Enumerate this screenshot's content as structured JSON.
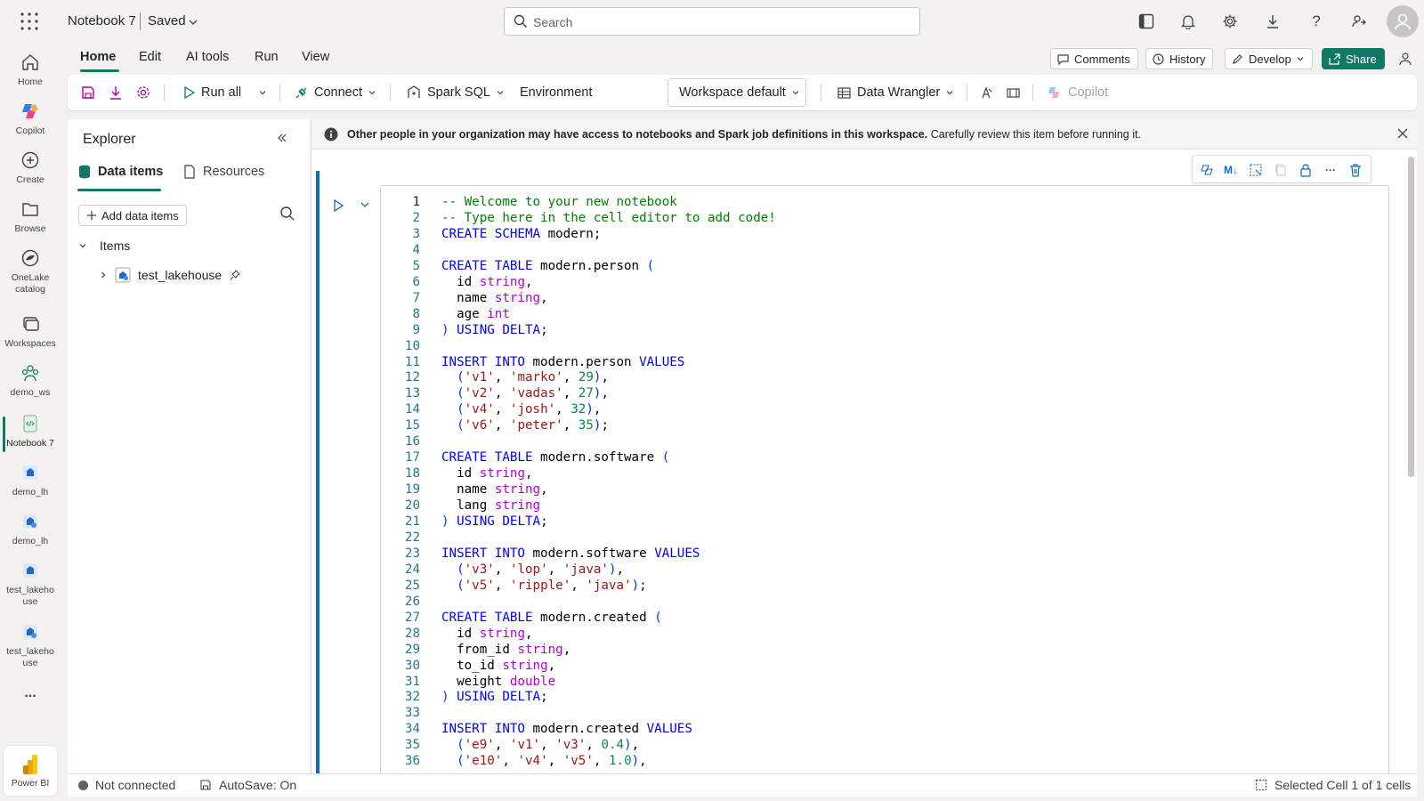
{
  "header": {
    "notebook_title": "Notebook 7",
    "save_status": "Saved",
    "search_placeholder": "Search",
    "icons": [
      "app-launcher-icon",
      "layout-icon",
      "bell-icon",
      "gear-icon",
      "download-icon",
      "help-icon",
      "share-people-icon",
      "avatar-icon"
    ]
  },
  "rail": {
    "items": [
      {
        "label": "Home",
        "icon": "home-icon"
      },
      {
        "label": "Copilot",
        "icon": "copilot-icon"
      },
      {
        "label": "Create",
        "icon": "plus-circle-icon"
      },
      {
        "label": "Browse",
        "icon": "folder-icon"
      },
      {
        "label": "OneLake catalog",
        "icon": "onelake-icon"
      },
      {
        "label": "Workspaces",
        "icon": "workspaces-icon"
      },
      {
        "label": "demo_ws",
        "icon": "workspace-people-icon"
      },
      {
        "label": "Notebook 7",
        "icon": "notebook-icon"
      },
      {
        "label": "demo_lh",
        "icon": "lakehouse-icon"
      },
      {
        "label": "demo_lh",
        "icon": "lakehouse-icon"
      },
      {
        "label": "test_lakehouse",
        "icon": "lakehouse-icon"
      },
      {
        "label": "test_lakehouse",
        "icon": "lakehouse-icon"
      }
    ],
    "more": "...",
    "powerbi": "Power BI"
  },
  "ribbon": {
    "tabs": [
      "Home",
      "Edit",
      "AI tools",
      "Run",
      "View"
    ],
    "comments": "Comments",
    "history": "History",
    "develop": "Develop",
    "share": "Share",
    "run_all": "Run all",
    "connect": "Connect",
    "language": "Spark SQL",
    "environment_label": "Environment",
    "environment_value": "Workspace default",
    "data_wrangler": "Data Wrangler",
    "copilot": "Copilot"
  },
  "explorer": {
    "title": "Explorer",
    "tab_data": "Data items",
    "tab_resources": "Resources",
    "add_button": "Add data items",
    "section": "Items",
    "tree_item": "test_lakehouse"
  },
  "notebook": {
    "banner_bold": "Other people in your organization may have access to notebooks and Spark job definitions in this workspace.",
    "banner_text": "Carefully review this item before running it.",
    "cell_tool_md": "M↓"
  },
  "code_lines": [
    "-- Welcome to your new notebook",
    "-- Type here in the cell editor to add code!",
    "CREATE SCHEMA modern;",
    "",
    "CREATE TABLE modern.person (",
    "  id string,",
    "  name string,",
    "  age int",
    ") USING DELTA;",
    "",
    "INSERT INTO modern.person VALUES",
    "  ('v1', 'marko', 29),",
    "  ('v2', 'vadas', 27),",
    "  ('v4', 'josh', 32),",
    "  ('v6', 'peter', 35);",
    "",
    "CREATE TABLE modern.software (",
    "  id string,",
    "  name string,",
    "  lang string",
    ") USING DELTA;",
    "",
    "INSERT INTO modern.software VALUES",
    "  ('v3', 'lop', 'java'),",
    "  ('v5', 'ripple', 'java');",
    "",
    "CREATE TABLE modern.created (",
    "  id string,",
    "  from_id string,",
    "  to_id string,",
    "  weight double",
    ") USING DELTA;",
    "",
    "INSERT INTO modern.created VALUES",
    "  ('e9', 'v1', 'v3', 0.4),",
    "  ('e10', 'v4', 'v5', 1.0),"
  ],
  "status": {
    "connection": "Not connected",
    "autosave": "AutoSave: On",
    "selection": "Selected Cell 1 of 1 cells"
  },
  "colors": {
    "accent": "#117865",
    "cell_active": "#0f6cbd",
    "keyword": "#0000ff",
    "string": "#a31515",
    "comment": "#008000",
    "number": "#098658",
    "type": "#af00db"
  }
}
